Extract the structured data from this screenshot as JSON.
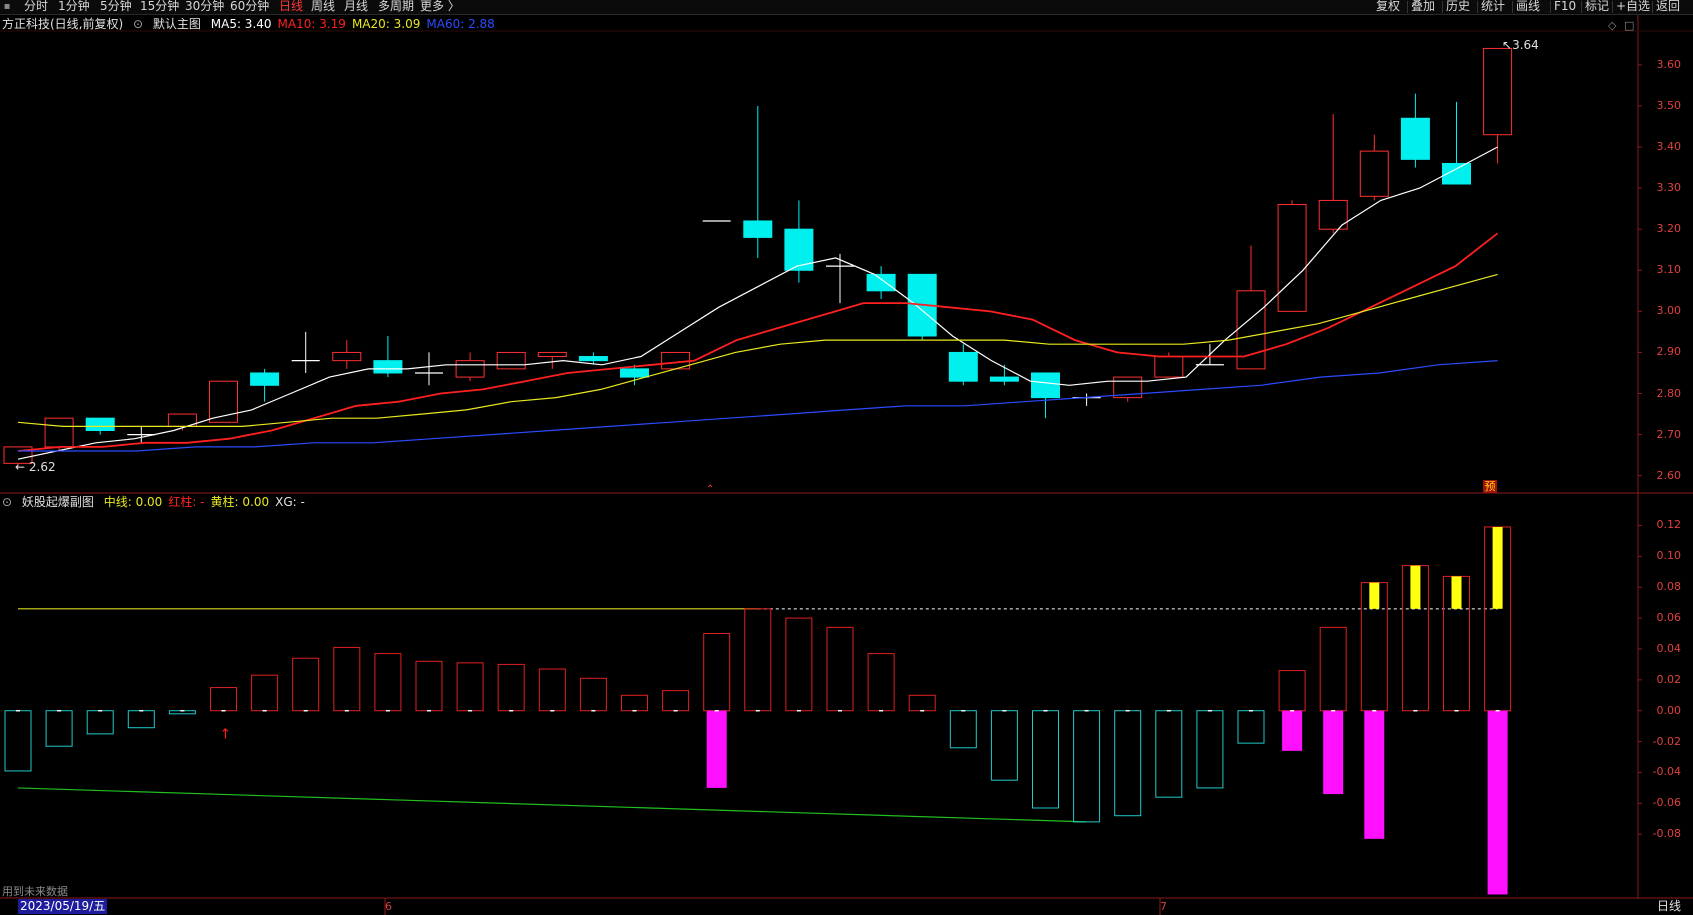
{
  "toolbar": {
    "timeframes": [
      "分时",
      "1分钟",
      "5分钟",
      "15分钟",
      "30分钟",
      "60分钟",
      "日线",
      "周线",
      "月线",
      "多周期",
      "更多 〉"
    ],
    "active": "日线",
    "right_buttons": [
      "复权",
      "叠加",
      "历史",
      "统计",
      "画线",
      "F10",
      "标记",
      "+自选",
      "返回"
    ]
  },
  "main_panel": {
    "stock": "方正科技(日线,前复权)",
    "template": "默认主图",
    "ma": [
      {
        "label": "MA5: 3.40",
        "color": "#ffffff"
      },
      {
        "label": "MA10: 3.19",
        "color": "#ff2020"
      },
      {
        "label": "MA20: 3.09",
        "color": "#e8e820"
      },
      {
        "label": "MA60: 2.88",
        "color": "#2a4bff"
      }
    ],
    "max_label": "3.64",
    "min_label": "2.62",
    "y_ticks": [
      "3.60",
      "3.50",
      "3.40",
      "3.30",
      "3.20",
      "3.10",
      "3.00",
      "2.90",
      "2.80",
      "2.70",
      "2.60"
    ]
  },
  "sub_panel": {
    "title": "妖股起爆副图",
    "labels": [
      {
        "text": "中线: 0.00",
        "color": "#e8e820"
      },
      {
        "text": "红柱: -",
        "color": "#ff2020"
      },
      {
        "text": "黄柱: 0.00",
        "color": "#e8e820"
      },
      {
        "text": "XG: -",
        "color": "#e0e0e0"
      }
    ],
    "y_ticks": [
      "0.12",
      "0.10",
      "0.08",
      "0.06",
      "0.04",
      "0.02",
      "0.00",
      "-0.02",
      "-0.04",
      "-0.06",
      "-0.08"
    ],
    "yu_label": "预"
  },
  "footer": {
    "note": "用到未来数据",
    "date": "2023/05/19/五",
    "months": [
      "6",
      "7"
    ],
    "period": "日线"
  },
  "chart_data": [
    {
      "type": "candlestick",
      "ylim": [
        2.57,
        3.68
      ],
      "candles": [
        {
          "o": 2.63,
          "h": 2.67,
          "l": 2.62,
          "c": 2.67
        },
        {
          "o": 2.67,
          "h": 2.74,
          "l": 2.66,
          "c": 2.74
        },
        {
          "o": 2.74,
          "h": 2.74,
          "l": 2.7,
          "c": 2.71
        },
        {
          "o": 2.7,
          "h": 2.72,
          "l": 2.68,
          "c": 2.7
        },
        {
          "o": 2.72,
          "h": 2.75,
          "l": 2.71,
          "c": 2.75
        },
        {
          "o": 2.73,
          "h": 2.83,
          "l": 2.73,
          "c": 2.83
        },
        {
          "o": 2.85,
          "h": 2.86,
          "l": 2.78,
          "c": 2.82
        },
        {
          "o": 2.88,
          "h": 2.95,
          "l": 2.85,
          "c": 2.88
        },
        {
          "o": 2.88,
          "h": 2.93,
          "l": 2.86,
          "c": 2.9
        },
        {
          "o": 2.88,
          "h": 2.94,
          "l": 2.84,
          "c": 2.85
        },
        {
          "o": 2.85,
          "h": 2.9,
          "l": 2.82,
          "c": 2.85
        },
        {
          "o": 2.84,
          "h": 2.9,
          "l": 2.83,
          "c": 2.88
        },
        {
          "o": 2.86,
          "h": 2.9,
          "l": 2.86,
          "c": 2.9
        },
        {
          "o": 2.89,
          "h": 2.9,
          "l": 2.86,
          "c": 2.9
        },
        {
          "o": 2.89,
          "h": 2.9,
          "l": 2.87,
          "c": 2.88
        },
        {
          "o": 2.86,
          "h": 2.87,
          "l": 2.82,
          "c": 2.84
        },
        {
          "o": 2.86,
          "h": 2.9,
          "l": 2.86,
          "c": 2.9
        },
        {
          "o": 3.22,
          "h": 3.22,
          "l": 3.22,
          "c": 3.22
        },
        {
          "o": 3.22,
          "h": 3.5,
          "l": 3.13,
          "c": 3.18
        },
        {
          "o": 3.2,
          "h": 3.27,
          "l": 3.07,
          "c": 3.1
        },
        {
          "o": 3.11,
          "h": 3.14,
          "l": 3.02,
          "c": 3.11
        },
        {
          "o": 3.09,
          "h": 3.11,
          "l": 3.03,
          "c": 3.05
        },
        {
          "o": 3.09,
          "h": 3.09,
          "l": 2.93,
          "c": 2.94
        },
        {
          "o": 2.9,
          "h": 2.92,
          "l": 2.82,
          "c": 2.83
        },
        {
          "o": 2.84,
          "h": 2.87,
          "l": 2.82,
          "c": 2.83
        },
        {
          "o": 2.85,
          "h": 2.85,
          "l": 2.74,
          "c": 2.79
        },
        {
          "o": 2.79,
          "h": 2.8,
          "l": 2.77,
          "c": 2.79
        },
        {
          "o": 2.79,
          "h": 2.84,
          "l": 2.78,
          "c": 2.84
        },
        {
          "o": 2.84,
          "h": 2.9,
          "l": 2.84,
          "c": 2.89
        },
        {
          "o": 2.87,
          "h": 2.92,
          "l": 2.87,
          "c": 2.87
        },
        {
          "o": 2.86,
          "h": 3.16,
          "l": 2.86,
          "c": 3.05
        },
        {
          "o": 3.0,
          "h": 3.27,
          "l": 3.0,
          "c": 3.26
        },
        {
          "o": 3.2,
          "h": 3.48,
          "l": 3.19,
          "c": 3.27
        },
        {
          "o": 3.28,
          "h": 3.43,
          "l": 3.27,
          "c": 3.39
        },
        {
          "o": 3.47,
          "h": 3.53,
          "l": 3.35,
          "c": 3.37
        },
        {
          "o": 3.36,
          "h": 3.51,
          "l": 3.31,
          "c": 3.31
        },
        {
          "o": 3.43,
          "h": 3.64,
          "l": 3.36,
          "c": 3.64
        }
      ],
      "series": [
        {
          "name": "MA5",
          "color": "#ffffff",
          "values": [
            2.64,
            2.66,
            2.68,
            2.69,
            2.71,
            2.74,
            2.76,
            2.8,
            2.84,
            2.86,
            2.86,
            2.87,
            2.87,
            2.87,
            2.88,
            2.87,
            2.89,
            2.95,
            3.01,
            3.06,
            3.11,
            3.13,
            3.09,
            3.02,
            2.94,
            2.88,
            2.83,
            2.82,
            2.83,
            2.83,
            2.84,
            2.93,
            3.01,
            3.1,
            3.21,
            3.27,
            3.3,
            3.35,
            3.4
          ]
        },
        {
          "name": "MA10",
          "color": "#ff2020",
          "values": [
            2.66,
            2.67,
            2.67,
            2.68,
            2.68,
            2.69,
            2.71,
            2.74,
            2.77,
            2.78,
            2.8,
            2.81,
            2.83,
            2.85,
            2.86,
            2.87,
            2.88,
            2.93,
            2.96,
            2.99,
            3.02,
            3.02,
            3.01,
            3.0,
            2.98,
            2.93,
            2.9,
            2.89,
            2.89,
            2.89,
            2.92,
            2.96,
            3.01,
            3.06,
            3.11,
            3.19
          ]
        },
        {
          "name": "MA20",
          "color": "#e8e820",
          "values": [
            2.73,
            2.72,
            2.72,
            2.72,
            2.72,
            2.72,
            2.73,
            2.74,
            2.74,
            2.75,
            2.76,
            2.78,
            2.79,
            2.81,
            2.84,
            2.87,
            2.9,
            2.92,
            2.93,
            2.93,
            2.93,
            2.93,
            2.93,
            2.92,
            2.92,
            2.92,
            2.92,
            2.93,
            2.95,
            2.97,
            3.0,
            3.03,
            3.06,
            3.09
          ]
        },
        {
          "name": "MA60",
          "color": "#2a4bff",
          "values": [
            2.66,
            2.66,
            2.66,
            2.67,
            2.67,
            2.68,
            2.68,
            2.69,
            2.7,
            2.71,
            2.72,
            2.73,
            2.74,
            2.75,
            2.76,
            2.77,
            2.77,
            2.78,
            2.79,
            2.8,
            2.81,
            2.82,
            2.84,
            2.85,
            2.87,
            2.88
          ]
        }
      ]
    },
    {
      "type": "bar",
      "ylim": [
        -0.12,
        0.13
      ],
      "bars": [
        -0.039,
        -0.023,
        -0.015,
        -0.011,
        -0.002,
        0.015,
        0.023,
        0.034,
        0.041,
        0.037,
        0.032,
        0.031,
        0.03,
        0.027,
        0.021,
        0.01,
        0.013,
        0.05,
        0.066,
        0.06,
        0.054,
        0.037,
        0.01,
        -0.024,
        -0.045,
        -0.063,
        -0.072,
        -0.068,
        -0.056,
        -0.05,
        -0.021,
        0.026,
        0.054,
        0.083,
        0.094,
        0.087,
        0.119
      ],
      "pink_bars": [
        0,
        0,
        0,
        0,
        0,
        0,
        0,
        0,
        0,
        0,
        0,
        0,
        0,
        0,
        0,
        0,
        0,
        -0.05,
        0,
        0,
        0,
        0,
        0,
        0,
        0,
        0,
        0,
        0,
        0,
        0,
        0,
        -0.026,
        -0.054,
        -0.083,
        0,
        0,
        -0.119
      ],
      "yellow_bars": [
        0,
        0,
        0,
        0,
        0,
        0,
        0,
        0,
        0,
        0,
        0,
        0,
        0,
        0,
        0,
        0,
        0,
        0,
        0,
        0,
        0,
        0,
        0,
        0,
        0,
        0,
        0,
        0,
        0,
        0,
        0,
        0,
        0,
        0.083,
        0.094,
        0.087,
        0.119
      ],
      "yellow_line": 0.066,
      "green_line": [
        -0.05,
        -0.072
      ]
    }
  ]
}
